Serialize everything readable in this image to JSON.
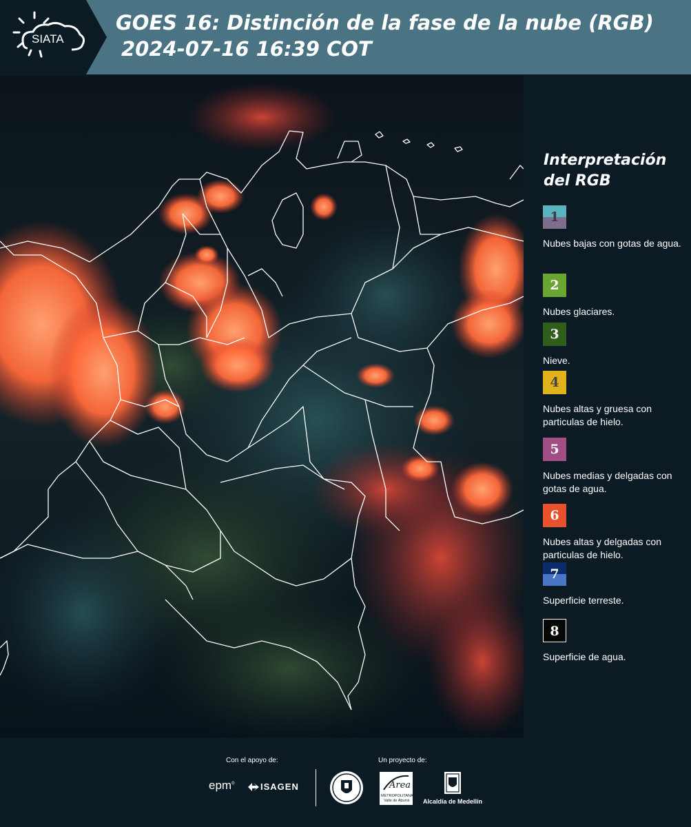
{
  "header": {
    "logo_text": "SIATA",
    "title_line1": "GOES 16: Distinción de la fase de la nube (RGB)",
    "title_line2": "2024-07-16 16:39 COT"
  },
  "legend": {
    "title_line1": "Interpretación",
    "title_line2": "del RGB",
    "items": [
      {
        "num": "1",
        "label": "Nubes bajas con gotas de agua.",
        "color_top": "#5ab3bf",
        "color_bottom": "#7d6f8c",
        "num_color": "#3a3a4a"
      },
      {
        "num": "2",
        "label": "Nubes glaciares.",
        "color_top": "#6aa531",
        "color_bottom": "#6aa531",
        "num_color": "#ffffff"
      },
      {
        "num": "3",
        "label": "Nieve.",
        "color_top": "#2f5e1c",
        "color_bottom": "#2f5e1c",
        "num_color": "#ffffff"
      },
      {
        "num": "4",
        "label": "Nubes altas y gruesa con particulas de hielo.",
        "color_top": "#e0b21c",
        "color_bottom": "#e0b21c",
        "num_color": "#444444"
      },
      {
        "num": "5",
        "label": "Nubes medias y delgadas con gotas de agua.",
        "color_top": "#a14d86",
        "color_bottom": "#a14d86",
        "num_color": "#ffffff"
      },
      {
        "num": "6",
        "label": "Nubes altas y delgadas con particulas de hielo.",
        "color_top": "#e8512b",
        "color_bottom": "#e8512b",
        "num_color": "#ffffff"
      },
      {
        "num": "7",
        "label": "Superficie terreste.",
        "color_top": "#0d2a6b",
        "color_bottom": "#4a76c7",
        "num_color": "#ffffff"
      },
      {
        "num": "8",
        "label": "Superficie de agua.",
        "color_top": "#050805",
        "color_bottom": "#050805",
        "num_color": "#ffffff"
      }
    ]
  },
  "footer": {
    "support_label": "Con el apoyo de:",
    "project_label": "Un proyecto de:",
    "epm_text": "epm",
    "isagen_text": "ISAGEN",
    "area_text": "Área",
    "area_sub1": "METROPOLITANA",
    "area_sub2": "Valle de Aburrá",
    "alcaldia_text": "Alcaldía de Medellín"
  },
  "colors": {
    "header_bg": "#4a7383",
    "logo_bg": "#0c1a24",
    "panel_bg": "#0c1a24",
    "cloud_orange": "#ff6a3a",
    "cloud_red": "#c8352a",
    "border_white": "#ffffff"
  }
}
